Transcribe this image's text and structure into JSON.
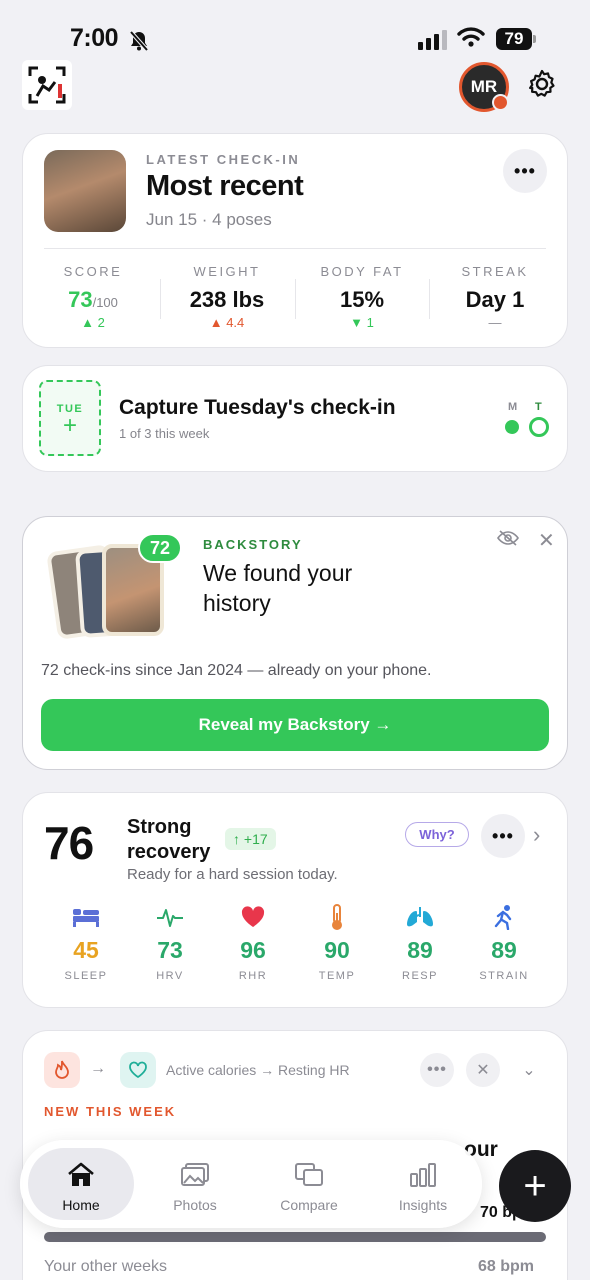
{
  "status_bar": {
    "time": "7:00",
    "battery": "79"
  },
  "header": {
    "avatar_initials": "MR"
  },
  "latest": {
    "kicker": "LATEST CHECK-IN",
    "title": "Most recent",
    "subtitle": "Jun 15 · 4 poses",
    "more": "•••",
    "stats": [
      {
        "label": "SCORE",
        "value": "73",
        "suffix": "/100",
        "delta": "▲ 2",
        "delta_color": "#34c759"
      },
      {
        "label": "WEIGHT",
        "value": "238 lbs",
        "suffix": "",
        "delta": "▲ 4.4",
        "delta_color": "#e2572e"
      },
      {
        "label": "BODY FAT",
        "value": "15%",
        "suffix": "",
        "delta": "▼ 1",
        "delta_color": "#34c759"
      },
      {
        "label": "STREAK",
        "value": "Day 1",
        "suffix": "",
        "delta": "—",
        "delta_color": "#8c8c94"
      }
    ]
  },
  "capture": {
    "day": "TUE",
    "plus": "+",
    "title": "Capture Tuesday's check-in",
    "subtitle": "1 of 3 this week",
    "days": [
      "M",
      "T"
    ]
  },
  "backstory": {
    "count_badge": "72",
    "kicker": "BACKSTORY",
    "title": "We found your history",
    "close": "✕",
    "description": "72 check-ins since Jan 2024 — already on your phone.",
    "button": "Reveal my Backstory →"
  },
  "recovery": {
    "score": "76",
    "title": "Strong recovery",
    "change": "↑ +17",
    "subtitle": "Ready for a hard session today.",
    "why": "Why?",
    "more": "•••",
    "chevron": "›",
    "metrics": [
      {
        "icon": "bed-icon",
        "value": "45",
        "label": "SLEEP",
        "color": "#e8a321"
      },
      {
        "icon": "pulse-icon",
        "value": "73",
        "label": "HRV",
        "color": "#2aa86a"
      },
      {
        "icon": "heart-icon",
        "value": "96",
        "label": "RHR",
        "color": "#2aa86a"
      },
      {
        "icon": "thermometer-icon",
        "value": "90",
        "label": "TEMP",
        "color": "#2aa86a"
      },
      {
        "icon": "lungs-icon",
        "value": "89",
        "label": "RESP",
        "color": "#2aa86a"
      },
      {
        "icon": "runner-icon",
        "value": "89",
        "label": "STRAIN",
        "color": "#2aa86a"
      }
    ]
  },
  "correlation": {
    "arrow": "→",
    "label": "Active calories → Resting HR",
    "more": "•••",
    "close": "✕",
    "chevron": "⌄",
    "kicker": "NEW THIS WEEK",
    "peek_text": "our",
    "peek_value": "70 bpm",
    "other_label": "Your other weeks",
    "other_value": "68 bpm"
  },
  "nav": {
    "items": [
      {
        "label": "Home",
        "icon": "home-icon",
        "active": true
      },
      {
        "label": "Photos",
        "icon": "photos-icon",
        "active": false
      },
      {
        "label": "Compare",
        "icon": "compare-icon",
        "active": false
      },
      {
        "label": "Insights",
        "icon": "insights-icon",
        "active": false
      }
    ],
    "fab": "+"
  },
  "colors": {
    "accent_green": "#34c759",
    "accent_orange": "#e2572e",
    "why_purple": "#7c62d9"
  }
}
